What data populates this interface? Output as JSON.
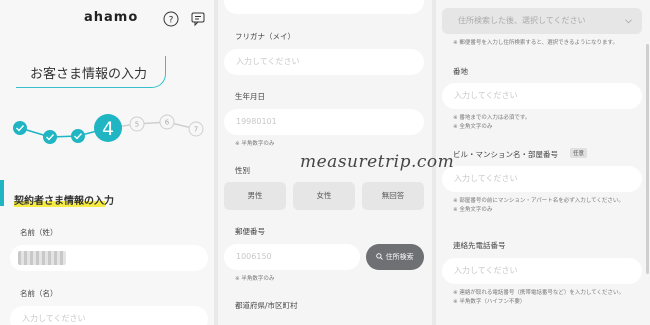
{
  "header": {
    "logo": "ahamo"
  },
  "steps": {
    "current": "4",
    "upcoming": [
      "5",
      "6",
      "7"
    ]
  },
  "page_title": "お客さま情報の入力",
  "section_title": "契約者さま情報の入力",
  "panel1": {
    "last_name_label": "名前（姓）",
    "first_name_label": "名前（名）",
    "first_name_placeholder": "入力してください"
  },
  "panel2": {
    "top_field_placeholder": "",
    "furigana_mei_label": "フリガナ（メイ）",
    "furigana_mei_placeholder": "入力してください",
    "birthdate_label": "生年月日",
    "birthdate_placeholder": "19980101",
    "birthdate_note": "※ 半角数字のみ",
    "gender_label": "性別",
    "gender_options": [
      "男性",
      "女性",
      "無回答"
    ],
    "postal_label": "郵便番号",
    "postal_placeholder": "1006150",
    "postal_button": "住所検索",
    "postal_note": "※ 半角数字のみ",
    "prefecture_label": "都道府県/市区町村"
  },
  "panel3": {
    "select_placeholder": "住所検索した後、選択してください",
    "select_note": "※ 郵便番号を入力し住所検索すると、選択できるようになります。",
    "banchi_label": "番地",
    "banchi_placeholder": "入力してください",
    "banchi_notes": [
      "※ 番地までの入力は必須です。",
      "※ 全角文字のみ"
    ],
    "building_label": "ビル・マンション名・部屋番号",
    "building_badge": "任意",
    "building_placeholder": "入力してください",
    "building_notes": [
      "※ 部屋番号の前にマンション・アパート名を必ず入力してください。",
      "※ 全角文字のみ"
    ],
    "phone_label": "連絡先電話番号",
    "phone_placeholder": "入力してください",
    "phone_notes": [
      "※ 連絡が取れる電話番号（携帯電話番号など）を入力してください。",
      "※ 半角数字（ハイフン不要）"
    ]
  },
  "watermark": "measuretrip.com",
  "colors": {
    "accent": "#1fb5c3",
    "highlight": "#f6eb43",
    "dark_button": "#6e7073"
  }
}
